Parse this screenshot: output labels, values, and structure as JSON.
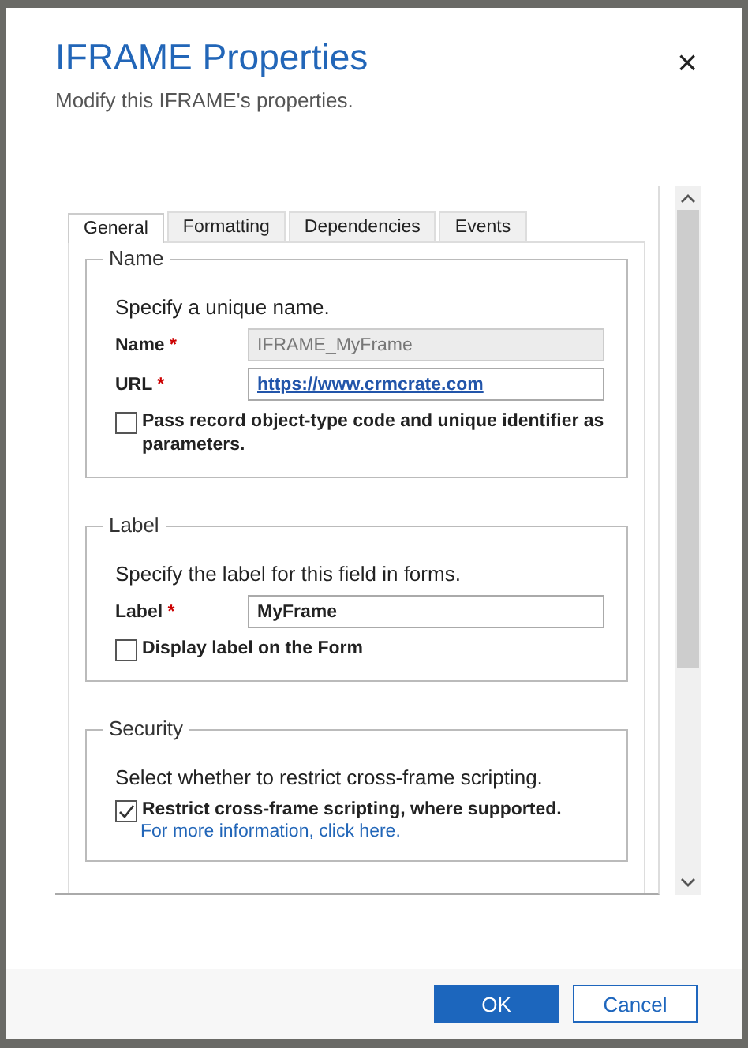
{
  "dialog": {
    "title": "IFRAME Properties",
    "subtitle": "Modify this IFRAME's properties.",
    "close": "×"
  },
  "tabs": [
    {
      "label": "General",
      "selected": true
    },
    {
      "label": "Formatting",
      "selected": false
    },
    {
      "label": "Dependencies",
      "selected": false
    },
    {
      "label": "Events",
      "selected": false
    }
  ],
  "sections": [
    {
      "legend": "Name",
      "description": "Specify a unique name.",
      "items": [
        {
          "kind": "field",
          "label": "Name",
          "required_mark": "*",
          "value": "IFRAME_MyFrame",
          "disabled": true,
          "link": false
        },
        {
          "kind": "field",
          "label": "URL",
          "required_mark": "*",
          "value": "https://www.crmcrate.com",
          "disabled": false,
          "link": true
        },
        {
          "kind": "checkbox",
          "label": "Pass record object-type code and unique identifier as parameters.",
          "checked": false
        }
      ]
    },
    {
      "legend": "Label",
      "description": "Specify the label for this field in forms.",
      "items": [
        {
          "kind": "field",
          "label": "Label",
          "required_mark": "*",
          "value": "MyFrame",
          "disabled": false,
          "link": false
        },
        {
          "kind": "checkbox",
          "label": "Display label on the Form",
          "checked": false
        }
      ]
    },
    {
      "legend": "Security",
      "description": "Select whether to restrict cross-frame scripting.",
      "items": [
        {
          "kind": "checkbox",
          "label": "Restrict cross-frame scripting, where supported.",
          "checked": true
        },
        {
          "kind": "link",
          "label": "For more information, click here."
        }
      ]
    }
  ],
  "buttons": [
    {
      "label": "OK",
      "primary": true
    },
    {
      "label": "Cancel",
      "primary": false
    }
  ]
}
